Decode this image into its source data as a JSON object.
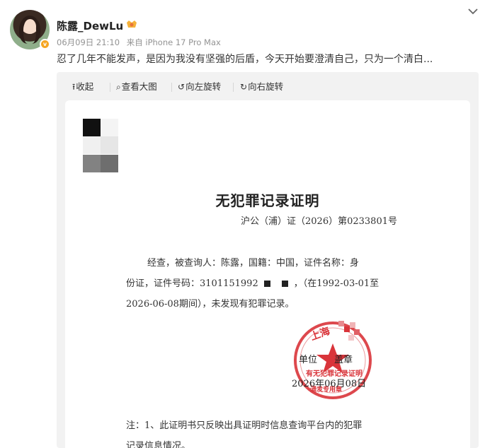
{
  "post": {
    "username": "陈露_DewLu",
    "date": "06月09日 21:10",
    "source": "来自 iPhone 17 Pro Max",
    "text": "忍了几年不能发声，是因为我没有坚强的后盾，今天开始要澄清自己，只为一个清白..."
  },
  "toolbar": {
    "collapse_label": "收起",
    "view_large_label": "查看大图",
    "rotate_left_label": "向左旋转",
    "rotate_right_label": "向右旋转"
  },
  "document": {
    "title": "无犯罪记录证明",
    "number": "沪公（浦）证（2026）第0233801号",
    "body_line1": "经查，被查询人：陈露，国籍：中国，证件名称：身",
    "body_line2_prefix": "份证，证件号码：3101151992",
    "body_line2_suffix": "，（在1992-03-01至",
    "body_line3": "2026-06-08期间），未发现有犯罪记录。",
    "seal_unit": "单位",
    "seal_stamp": "盖章",
    "seal_date": "2026年06月08日",
    "seal_top": "上海",
    "seal_ring": "有无犯罪记录证明",
    "seal_ring2": "浦发专用章",
    "note_line1": "注：1、此证明书只反映出具证明时信息查询平台内的犯罪",
    "note_line2": "记录信息情况。"
  },
  "colors": {
    "seal_red": "#d9343a",
    "badge_orange": "#f5a623",
    "meta_gray": "#939393"
  },
  "icons": {
    "collapse": "arrow-up-icon",
    "view": "magnifier-icon",
    "rotate_left": "rotate-left-icon",
    "rotate_right": "rotate-right-icon",
    "menu": "chevron-down-icon"
  }
}
